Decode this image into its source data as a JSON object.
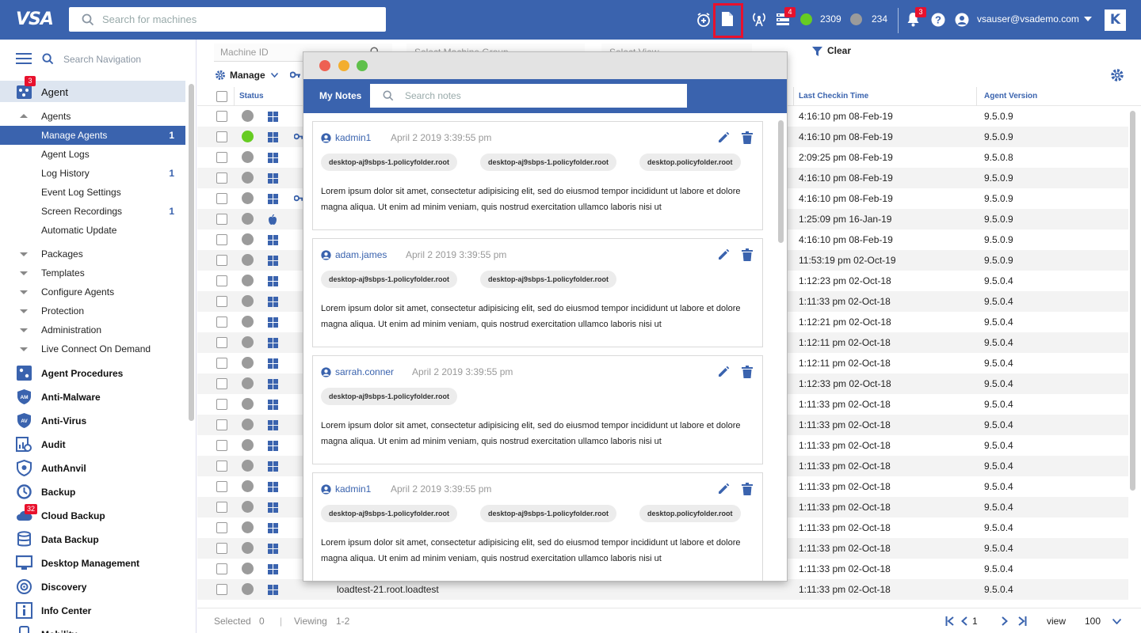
{
  "topbar": {
    "logo": "VSA",
    "search_placeholder": "Search for machines",
    "alerts_badge": "4",
    "online_count": "2309",
    "offline_count": "234",
    "notifications_badge": "3",
    "username": "vsauser@vsademo.com",
    "brand_letter": "K",
    "colors": {
      "bar": "#3a63ae",
      "online": "#66cc22",
      "offline": "#9b9b9b",
      "badge": "#e8112d"
    }
  },
  "sidebar": {
    "search_placeholder": "Search Navigation",
    "agent_module": {
      "label": "Agent",
      "badge": "3"
    },
    "agent_items": [
      {
        "label": "Agents",
        "count": ""
      },
      {
        "label": "Manage Agents",
        "count": "1"
      },
      {
        "label": "Agent Logs",
        "count": ""
      },
      {
        "label": "Log History",
        "count": "1"
      },
      {
        "label": "Event Log Settings",
        "count": ""
      },
      {
        "label": "Screen Recordings",
        "count": "1"
      },
      {
        "label": "Automatic Update",
        "count": ""
      }
    ],
    "folders": [
      "Packages",
      "Templates",
      "Configure Agents",
      "Protection",
      "Administration",
      "Live Connect On Demand"
    ],
    "modules": [
      {
        "label": "Agent Procedures",
        "icon": "agent-procedures-icon"
      },
      {
        "label": "Anti-Malware",
        "icon": "anti-malware-icon",
        "abbr": "AM"
      },
      {
        "label": "Anti-Virus",
        "icon": "anti-virus-icon",
        "abbr": "AV"
      },
      {
        "label": "Audit",
        "icon": "audit-icon"
      },
      {
        "label": "AuthAnvil",
        "icon": "authanvil-icon"
      },
      {
        "label": "Backup",
        "icon": "backup-icon"
      },
      {
        "label": "Cloud Backup",
        "icon": "cloud-backup-icon",
        "badge": "32"
      },
      {
        "label": "Data Backup",
        "icon": "data-backup-icon"
      },
      {
        "label": "Desktop Management",
        "icon": "desktop-management-icon"
      },
      {
        "label": "Discovery",
        "icon": "discovery-icon"
      },
      {
        "label": "Info Center",
        "icon": "info-center-icon"
      },
      {
        "label": "Mobility",
        "icon": "mobility-icon"
      }
    ]
  },
  "filters": {
    "machine_id_placeholder": "Machine ID",
    "machine_group_placeholder": "Select Machine Group",
    "view_placeholder": "Select View",
    "clear_label": "Clear"
  },
  "toolbar": {
    "manage_label": "Manage"
  },
  "grid": {
    "headers": {
      "status": "Status",
      "last_checkin": "Last Checkin Time",
      "agent_version": "Agent Version"
    },
    "rows": [
      {
        "online": false,
        "os": "windows",
        "key": false,
        "name": "",
        "checkin": "4:16:10 pm 08-Feb-19",
        "version": "9.5.0.9"
      },
      {
        "online": true,
        "os": "windows",
        "key": true,
        "name": "",
        "checkin": "4:16:10 pm 08-Feb-19",
        "version": "9.5.0.9"
      },
      {
        "online": false,
        "os": "windows",
        "key": false,
        "name": "",
        "checkin": "2:09:25 pm 08-Feb-19",
        "version": "9.5.0.8"
      },
      {
        "online": false,
        "os": "windows",
        "key": false,
        "name": "",
        "checkin": "4:16:10 pm 08-Feb-19",
        "version": "9.5.0.9"
      },
      {
        "online": false,
        "os": "windows",
        "key": true,
        "name": "",
        "checkin": "4:16:10 pm 08-Feb-19",
        "version": "9.5.0.9"
      },
      {
        "online": false,
        "os": "apple",
        "key": false,
        "name": "",
        "checkin": "1:25:09 pm 16-Jan-19",
        "version": "9.5.0.9"
      },
      {
        "online": false,
        "os": "windows",
        "key": false,
        "name": "",
        "checkin": "4:16:10 pm 08-Feb-19",
        "version": "9.5.0.9"
      },
      {
        "online": false,
        "os": "windows",
        "key": false,
        "name": "",
        "checkin": "11:53:19 pm 02-Oct-19",
        "version": "9.5.0.9"
      },
      {
        "online": false,
        "os": "windows",
        "key": false,
        "name": "",
        "checkin": "1:12:23 pm 02-Oct-18",
        "version": "9.5.0.4"
      },
      {
        "online": false,
        "os": "windows",
        "key": false,
        "name": "",
        "checkin": "1:11:33 pm 02-Oct-18",
        "version": "9.5.0.4"
      },
      {
        "online": false,
        "os": "windows",
        "key": false,
        "name": "",
        "checkin": "1:12:21 pm 02-Oct-18",
        "version": "9.5.0.4"
      },
      {
        "online": false,
        "os": "windows",
        "key": false,
        "name": "",
        "checkin": "1:12:11 pm 02-Oct-18",
        "version": "9.5.0.4"
      },
      {
        "online": false,
        "os": "windows",
        "key": false,
        "name": "",
        "checkin": "1:12:11 pm 02-Oct-18",
        "version": "9.5.0.4"
      },
      {
        "online": false,
        "os": "windows",
        "key": false,
        "name": "",
        "checkin": "1:12:33 pm 02-Oct-18",
        "version": "9.5.0.4"
      },
      {
        "online": false,
        "os": "windows",
        "key": false,
        "name": "",
        "checkin": "1:11:33 pm 02-Oct-18",
        "version": "9.5.0.4"
      },
      {
        "online": false,
        "os": "windows",
        "key": false,
        "name": "",
        "checkin": "1:11:33 pm 02-Oct-18",
        "version": "9.5.0.4"
      },
      {
        "online": false,
        "os": "windows",
        "key": false,
        "name": "",
        "checkin": "1:11:33 pm 02-Oct-18",
        "version": "9.5.0.4"
      },
      {
        "online": false,
        "os": "windows",
        "key": false,
        "name": "",
        "checkin": "1:11:33 pm 02-Oct-18",
        "version": "9.5.0.4"
      },
      {
        "online": false,
        "os": "windows",
        "key": false,
        "name": "",
        "checkin": "1:11:33 pm 02-Oct-18",
        "version": "9.5.0.4"
      },
      {
        "online": false,
        "os": "windows",
        "key": false,
        "name": "",
        "checkin": "1:11:33 pm 02-Oct-18",
        "version": "9.5.0.4"
      },
      {
        "online": false,
        "os": "windows",
        "key": false,
        "name": "",
        "checkin": "1:11:33 pm 02-Oct-18",
        "version": "9.5.0.4"
      },
      {
        "online": false,
        "os": "windows",
        "key": false,
        "name": "",
        "checkin": "1:11:33 pm 02-Oct-18",
        "version": "9.5.0.4"
      },
      {
        "online": false,
        "os": "windows",
        "key": false,
        "name": "",
        "checkin": "1:11:33 pm 02-Oct-18",
        "version": "9.5.0.4"
      },
      {
        "online": false,
        "os": "windows",
        "key": false,
        "name": "loadtest-21.root.loadtest",
        "checkin": "1:11:33 pm 02-Oct-18",
        "version": "9.5.0.4"
      }
    ]
  },
  "footer": {
    "selected_label": "Selected",
    "selected_value": "0",
    "viewing_label": "Viewing",
    "viewing_value": "1-2",
    "page": "1",
    "view_label": "view",
    "page_size": "100"
  },
  "notes": {
    "title": "My Notes",
    "search_placeholder": "Search notes",
    "items": [
      {
        "user": "kadmin1",
        "date": "April 2 2019 3:39:55 pm",
        "tags": [
          "desktop-aj9sbps-1.policyfolder.root",
          "desktop-aj9sbps-1.policyfolder.root",
          "desktop.policyfolder.root"
        ],
        "body": "Lorem ipsum dolor sit amet, consectetur adipisicing elit, sed do eiusmod tempor incididunt ut labore et dolore magna aliqua. Ut enim ad minim veniam, quis nostrud exercitation ullamco laboris nisi ut"
      },
      {
        "user": "adam.james",
        "date": "April 2 2019 3:39:55 pm",
        "tags": [
          "desktop-aj9sbps-1.policyfolder.root",
          "desktop-aj9sbps-1.policyfolder.root"
        ],
        "body": "Lorem ipsum dolor sit amet, consectetur adipisicing elit, sed do eiusmod tempor incididunt ut labore et dolore magna aliqua. Ut enim ad minim veniam, quis nostrud exercitation ullamco laboris nisi ut"
      },
      {
        "user": "sarrah.conner",
        "date": "April 2 2019 3:39:55 pm",
        "tags": [
          "desktop-aj9sbps-1.policyfolder.root"
        ],
        "body": "Lorem ipsum dolor sit amet, consectetur adipisicing elit, sed do eiusmod tempor incididunt ut labore et dolore magna aliqua. Ut enim ad minim veniam, quis nostrud exercitation ullamco laboris nisi ut"
      },
      {
        "user": "kadmin1",
        "date": "April 2 2019 3:39:55 pm",
        "tags": [
          "desktop-aj9sbps-1.policyfolder.root",
          "desktop-aj9sbps-1.policyfolder.root",
          "desktop.policyfolder.root"
        ],
        "body": "Lorem ipsum dolor sit amet, consectetur adipisicing elit, sed do eiusmod tempor incididunt ut labore et dolore magna aliqua. Ut enim ad minim veniam, quis nostrud exercitation ullamco laboris nisi ut"
      }
    ]
  }
}
